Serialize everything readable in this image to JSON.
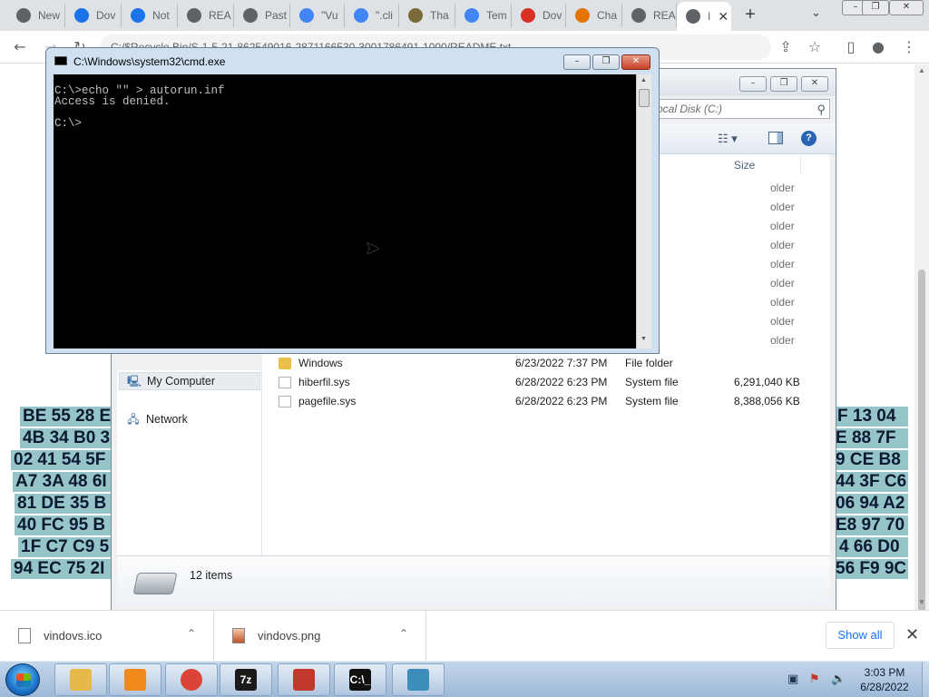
{
  "browser": {
    "tabs": [
      {
        "label": "New",
        "favicon": "chrome-icon",
        "color": "#5f6368"
      },
      {
        "label": "Dov",
        "favicon": "download-icon",
        "color": "#1a73e8"
      },
      {
        "label": "Not",
        "favicon": "cloud-icon",
        "color": "#1a73e8"
      },
      {
        "label": "REA",
        "favicon": "chrome-icon",
        "color": "#5f6368"
      },
      {
        "label": "Past",
        "favicon": "chrome-icon",
        "color": "#5f6368"
      },
      {
        "label": "\"Vu",
        "favicon": "google-icon",
        "color": "#4285f4"
      },
      {
        "label": "\".cli",
        "favicon": "google-icon",
        "color": "#4285f4"
      },
      {
        "label": "Tha",
        "favicon": "site-icon",
        "color": "#7a6a3a"
      },
      {
        "label": "Tem",
        "favicon": "google-icon",
        "color": "#4285f4"
      },
      {
        "label": "Dov",
        "favicon": "opera-icon",
        "color": "#d93025"
      },
      {
        "label": "Cha",
        "favicon": "chart-icon",
        "color": "#e37400"
      },
      {
        "label": "REA",
        "favicon": "chrome-icon",
        "color": "#5f6368"
      },
      {
        "label": "I",
        "favicon": "chrome-icon",
        "color": "#5f6368",
        "active": true
      }
    ],
    "url": "C:/$Recycle.Bin/S-1-5-21-862549016-2871166530-3001786491-1000/README.txt"
  },
  "hex_rows": [
    {
      "left": "BE 55 28 E",
      "right": "F 13 04"
    },
    {
      "left": "4B 34 B0 3",
      "right": "E 88 7F"
    },
    {
      "left": "02 41 54 5F",
      "right": "9 CE B8"
    },
    {
      "left": "A7 3A 48 6I",
      "right": "44 3F C6"
    },
    {
      "left": "81 DE 35 B",
      "right": "06 94 A2"
    },
    {
      "left": "40 FC 95 B",
      "right": "E8 97 70"
    },
    {
      "left": "1F C7 C9 5",
      "right": "4 66 D0"
    },
    {
      "left": "94 EC 75 2I",
      "right": "56 F9 9C"
    }
  ],
  "explorer": {
    "search_placeholder": "ocal Disk (C:)",
    "column_size": "Size",
    "partial_types": [
      "older",
      "older",
      "older",
      "older",
      "older",
      "older",
      "older",
      "older",
      "older"
    ],
    "nav": [
      {
        "label": "My Computer",
        "icon": "computer-icon",
        "selected": true
      },
      {
        "label": "Network",
        "icon": "network-icon",
        "selected": false
      }
    ],
    "files": [
      {
        "name": "Windows",
        "date": "6/23/2022 7:37 PM",
        "type": "File folder",
        "size": "",
        "icon": "folder-icon"
      },
      {
        "name": "hiberfil.sys",
        "date": "6/28/2022 6:23 PM",
        "type": "System file",
        "size": "6,291,040 KB",
        "icon": "file-icon"
      },
      {
        "name": "pagefile.sys",
        "date": "6/28/2022 6:23 PM",
        "type": "System file",
        "size": "8,388,056 KB",
        "icon": "file-icon"
      }
    ],
    "item_count": "12 items"
  },
  "cmd": {
    "title": "C:\\Windows\\system32\\cmd.exe",
    "output": "C:\\>echo \"\" > autorun.inf\nAccess is denied.\n\nC:\\>"
  },
  "downloads": {
    "items": [
      {
        "name": "vindovs.ico",
        "icon": "file-icon"
      },
      {
        "name": "vindovs.png",
        "icon": "image-icon"
      }
    ],
    "show_all": "Show all"
  },
  "taskbar": {
    "apps": [
      {
        "name": "explorer",
        "icon": "folder-icon",
        "color": "#e6b94a"
      },
      {
        "name": "media-player",
        "icon": "media-icon",
        "color": "#f08a1c"
      },
      {
        "name": "chrome",
        "icon": "chrome-icon",
        "color": "#db4437"
      },
      {
        "name": "7zip",
        "icon": "7z-icon",
        "color": "#1a1a1a",
        "glyph": "7z"
      },
      {
        "name": "toolbox",
        "icon": "toolbox-icon",
        "color": "#c0392b"
      },
      {
        "name": "cmd",
        "icon": "cmd-icon",
        "color": "#111111",
        "glyph": "C:\\_"
      },
      {
        "name": "network-tool",
        "icon": "cubes-icon",
        "color": "#3c8dbc"
      }
    ],
    "time": "3:03 PM",
    "date": "6/28/2022"
  }
}
